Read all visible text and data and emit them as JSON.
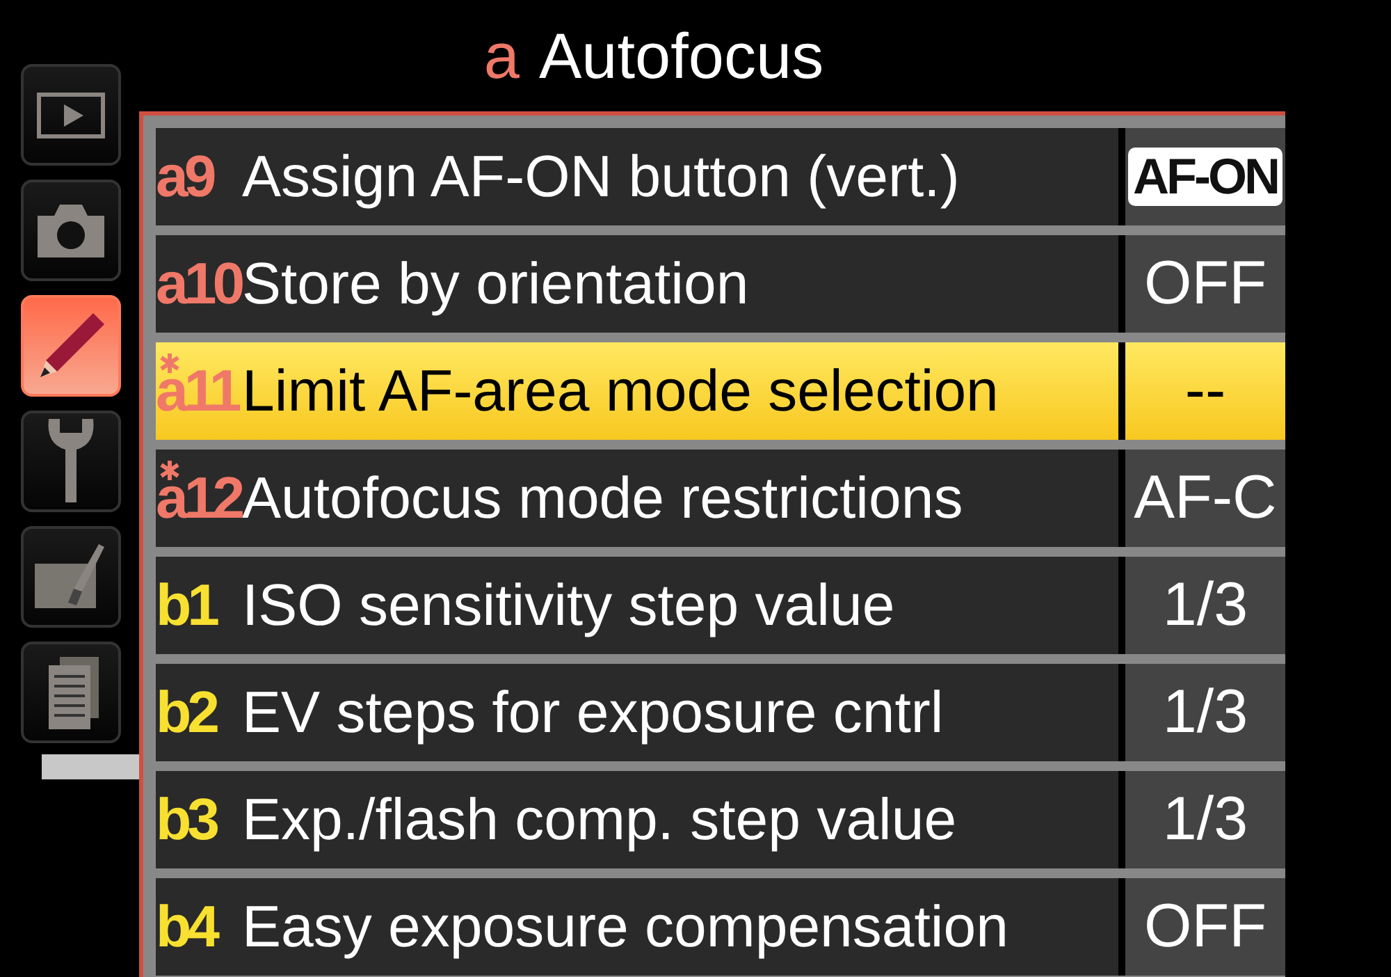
{
  "header": {
    "code": "a",
    "title": "Autofocus"
  },
  "sidebar": {
    "items": [
      {
        "kind": "playback",
        "selected": false
      },
      {
        "kind": "camera",
        "selected": false
      },
      {
        "kind": "pencil",
        "selected": true
      },
      {
        "kind": "wrench",
        "selected": false
      },
      {
        "kind": "retouch",
        "selected": false
      },
      {
        "kind": "recent",
        "selected": false
      }
    ]
  },
  "menu": {
    "items": [
      {
        "code": "a9",
        "color": "#f07868",
        "changed": false,
        "label": "Assign AF-ON button (vert.)",
        "value": "AF-ON",
        "kind": "badge",
        "selected": false
      },
      {
        "code": "a10",
        "color": "#f07868",
        "changed": false,
        "label": "Store by orientation",
        "value": "OFF",
        "kind": "text",
        "selected": false
      },
      {
        "code": "a11",
        "color": "#f07868",
        "changed": true,
        "label": "Limit AF-area mode selection",
        "value": "--",
        "kind": "text",
        "selected": true
      },
      {
        "code": "a12",
        "color": "#f07868",
        "changed": true,
        "label": "Autofocus mode restrictions",
        "value": "AF-C",
        "kind": "text",
        "selected": false
      },
      {
        "code": "b1",
        "color": "#f8e030",
        "changed": false,
        "label": "ISO sensitivity step value",
        "value": "1/3",
        "kind": "text",
        "selected": false
      },
      {
        "code": "b2",
        "color": "#f8e030",
        "changed": false,
        "label": "EV steps for exposure cntrl",
        "value": "1/3",
        "kind": "text",
        "selected": false
      },
      {
        "code": "b3",
        "color": "#f8e030",
        "changed": false,
        "label": "Exp./flash comp. step value",
        "value": "1/3",
        "kind": "text",
        "selected": false
      },
      {
        "code": "b4",
        "color": "#f8e030",
        "changed": false,
        "label": "Easy exposure compensation",
        "value": "OFF",
        "kind": "text",
        "selected": false
      }
    ]
  }
}
